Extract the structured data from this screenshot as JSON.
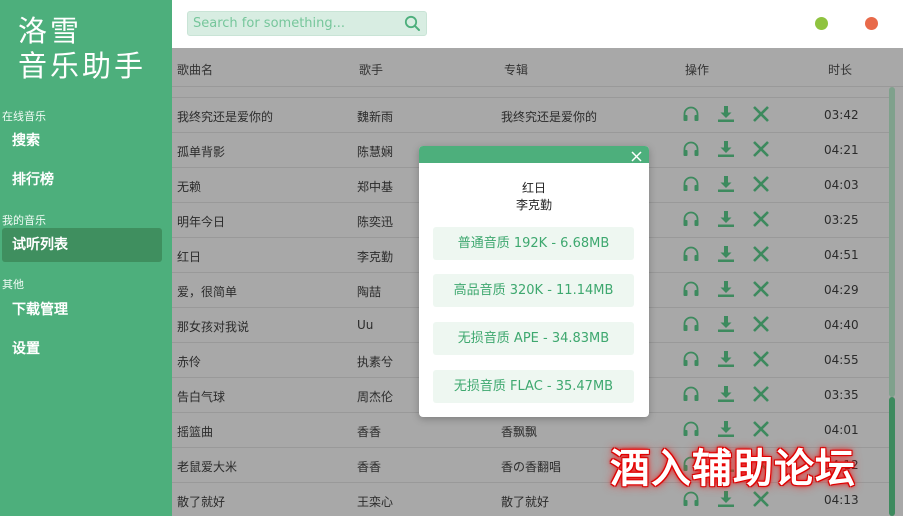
{
  "sidebar": {
    "logo_line1": "洛雪",
    "logo_line2": "音乐助手",
    "sections": [
      {
        "title": "在线音乐",
        "items": [
          "搜索",
          "排行榜"
        ]
      },
      {
        "title": "我的音乐",
        "items": [
          "试听列表"
        ]
      },
      {
        "title": "其他",
        "items": [
          "下载管理",
          "设置"
        ]
      }
    ],
    "active_item": "试听列表"
  },
  "search": {
    "placeholder": "Search for something..."
  },
  "window": {
    "dot_min_color": "#8fc33f",
    "dot_close_color": "#e86a4a"
  },
  "table": {
    "headers": {
      "name": "歌曲名",
      "artist": "歌手",
      "album": "专辑",
      "ops": "操作",
      "duration": "时长"
    },
    "rows": [
      {
        "name": "我终究还是爱你的",
        "artist": "魏新雨",
        "album": "我终究还是爱你的",
        "duration": "03:42"
      },
      {
        "name": "孤单背影",
        "artist": "陈慧娴",
        "album": "",
        "duration": "04:21"
      },
      {
        "name": "无赖",
        "artist": "郑中基",
        "album": "",
        "duration": "04:03"
      },
      {
        "name": "明年今日",
        "artist": "陈奕迅",
        "album": "",
        "duration": "03:25"
      },
      {
        "name": "红日",
        "artist": "李克勤",
        "album": "",
        "duration": "04:51"
      },
      {
        "name": "爱，很简单",
        "artist": "陶喆",
        "album": "",
        "duration": "04:29"
      },
      {
        "name": "那女孩对我说",
        "artist": "Uu",
        "album": "",
        "duration": "04:40"
      },
      {
        "name": "赤伶",
        "artist": "执素兮",
        "album": "",
        "duration": "04:55"
      },
      {
        "name": "告白气球",
        "artist": "周杰伦",
        "album": "",
        "duration": "03:35"
      },
      {
        "name": "摇篮曲",
        "artist": "香香",
        "album": "香飘飘",
        "duration": "04:01"
      },
      {
        "name": "老鼠爱大米",
        "artist": "香香",
        "album": "香の香翻唱",
        "duration": "04:12"
      },
      {
        "name": "散了就好",
        "artist": "王栾心",
        "album": "散了就好",
        "duration": "04:13"
      }
    ],
    "scroll_position": 0.72
  },
  "modal": {
    "song": "红日",
    "artist": "李克勤",
    "options": [
      "普通音质 192K - 6.68MB",
      "高品音质 320K - 11.14MB",
      "无损音质 APE - 34.83MB",
      "无损音质 FLAC - 35.47MB"
    ]
  },
  "colors": {
    "accent": "#4daf7c",
    "accent_dark": "#3d8a5e",
    "icon": "#3d8a5e"
  },
  "watermark": "酒入辅助论坛"
}
